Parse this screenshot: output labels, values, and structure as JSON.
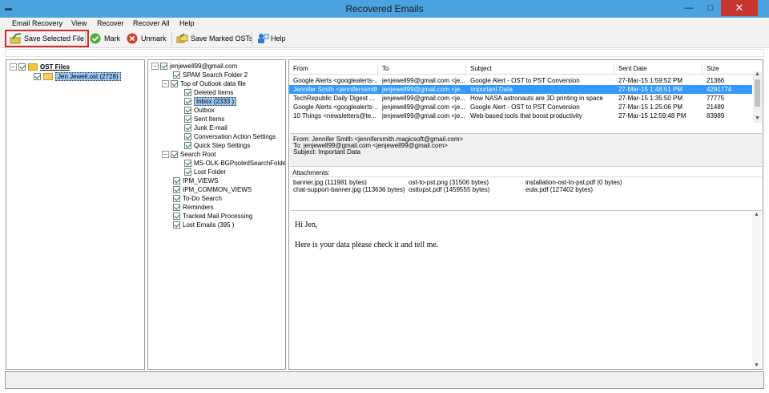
{
  "window": {
    "title": "Recovered Emails",
    "min_glyph": "—",
    "max_glyph": "□",
    "close_glyph": "✕"
  },
  "menu": [
    "Email Recovery",
    "View",
    "Recover",
    "Recover All",
    "Help"
  ],
  "toolbar": {
    "save_selected": "Save Selected File",
    "mark": "Mark",
    "unmark": "Unmark",
    "save_marked": "Save Marked OSTs",
    "help": "Help"
  },
  "left_tree": {
    "root": "OST Files",
    "file": "Jen Jewell.ost (2728)"
  },
  "folder_tree": {
    "account": "jenjewell99@gmail.com",
    "items": [
      "SPAM Search Folder 2",
      "Top of Outlook data file",
      "Deleted Items",
      "Inbox  (2333 )",
      "Outbox",
      "Sent Items",
      "Junk E-mail",
      "Conversation Action Settings",
      "Quick Step Settings",
      "Search Root",
      "MS-OLK-BGPooledSearchFolder(",
      "Lost Folder",
      "IPM_VIEWS",
      "IPM_COMMON_VIEWS",
      "To-Do Search",
      "Reminders",
      "Tracked Mail Processing",
      "Lost Emails  (395 )"
    ]
  },
  "email_list": {
    "columns": [
      "From",
      "To",
      "Subject",
      "Sent Date",
      "Size"
    ],
    "rows": [
      {
        "from": "Google Alerts <googlealerts-...",
        "to": "jenjewell99@gmail.com <je...",
        "subject": "Google Alert - OST to PST Conversion",
        "date": "27-Mar-15 1:59:52 PM",
        "size": "21366"
      },
      {
        "from": "Jennifer Smith <jenniferssmith...",
        "to": "jenjewell99@gmail.com <je...",
        "subject": "Important Data",
        "date": "27-Mar-15 1:48:51 PM",
        "size": "4291774"
      },
      {
        "from": "TechRepublic Daily Digest ...",
        "to": "jenjewell99@gmail.com <je...",
        "subject": "How NASA astronauts are 3D printing in space",
        "date": "27-Mar-15 1:35:50 PM",
        "size": "77775"
      },
      {
        "from": "Google Alerts <googlealerts-...",
        "to": "jenjewell99@gmail.com <je...",
        "subject": "Google Alert - OST to PST Conversion",
        "date": "27-Mar-15 1:25:06 PM",
        "size": "21489"
      },
      {
        "from": "10 Things <newsletters@te...",
        "to": "jenjewell99@gmail.com <je...",
        "subject": "Web-based tools that boost productivity",
        "date": "27-Mar-15 12:59:48 PM",
        "size": "83989"
      }
    ]
  },
  "header_info": {
    "from": "From: Jennifer Smith <jennifersmith.magicsoft@gmail.com>",
    "to": "To: jenjewell99@gmail.com <jenjewell99@gmail.com>",
    "subject": "Subject: Important Data"
  },
  "attachments": {
    "label": "Attachments:",
    "items": [
      "banner.jpg (111981 bytes)",
      "ost-to-pst.png (31506 bytes)",
      "installation-ost-to-pst.pdf (0 bytes)",
      "chat-support-banner.jpg (113636 bytes)",
      "osttopst.pdf (1459555 bytes)",
      "eula.pdf (127402 bytes)"
    ]
  },
  "message_body": {
    "greeting": "Hi Jen,",
    "text": "Here is your data please check it and tell me."
  }
}
